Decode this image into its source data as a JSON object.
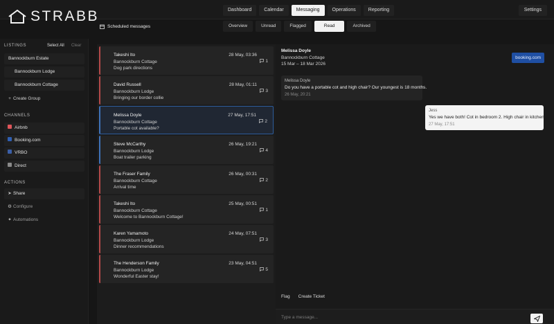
{
  "app": {
    "logo": "STRABB"
  },
  "nav": {
    "tabs": [
      "Dashboard",
      "Calendar",
      "Messaging",
      "Operations",
      "Reporting"
    ],
    "active": "Messaging",
    "settings": "Settings"
  },
  "sidebar": {
    "listings": {
      "title": "LISTINGS",
      "select_all": "Select All",
      "clear": "Clear",
      "items": [
        "Bannockburn Estate",
        "Bannockburn Lodge",
        "Bannockburn Cottage"
      ],
      "create_group": "Create Group"
    },
    "channels": {
      "title": "CHANNELS",
      "items": [
        {
          "label": "Airbnb",
          "color": "#e0555a"
        },
        {
          "label": "Booking.com",
          "color": "#2f5fb3"
        },
        {
          "label": "VRBO",
          "color": "#3b5fa8"
        },
        {
          "label": "Direct",
          "color": "#8a8a8a"
        }
      ]
    },
    "actions": {
      "title": "ACTIONS",
      "items": [
        {
          "label": "Share",
          "icon": "share-icon"
        },
        {
          "label": "Configure",
          "icon": "gear-icon"
        },
        {
          "label": "Automations",
          "icon": "sparkle-icon"
        }
      ]
    }
  },
  "header": {
    "scheduled": "Scheduled messages",
    "subtabs": [
      "Overview",
      "Unread",
      "Flagged",
      "Read",
      "Archived"
    ],
    "active_subtab": "Read"
  },
  "messages": [
    {
      "name": "Takeshi Ito",
      "date": "28 May, 03:36",
      "property": "Bannockburn Cottage",
      "subject": "Dog park directions",
      "count": "1",
      "channel": "airbnb"
    },
    {
      "name": "David Russell",
      "date": "28 May, 01:11",
      "property": "Bannockburn Lodge",
      "subject": "Bringing our border collie",
      "count": "3",
      "channel": "airbnb"
    },
    {
      "name": "Melissa Doyle",
      "date": "27 May, 17:51",
      "property": "Bannockburn Cottage",
      "subject": "Portable cot available?",
      "count": "2",
      "channel": "booking",
      "selected": true
    },
    {
      "name": "Steve McCarthy",
      "date": "26 May, 19:21",
      "property": "Bannockburn Lodge",
      "subject": "Boat trailer parking",
      "count": "4",
      "channel": "vrbo"
    },
    {
      "name": "The Fraser Family",
      "date": "26 May, 00:31",
      "property": "Bannockburn Cottage",
      "subject": "Arrival time",
      "count": "2",
      "channel": "airbnb"
    },
    {
      "name": "Takeshi Ito",
      "date": "25 May, 00:51",
      "property": "Bannockburn Cottage",
      "subject": "Welcome to Bannockburn Cottage!",
      "count": "1",
      "channel": "airbnb"
    },
    {
      "name": "Karen Yamamoto",
      "date": "24 May, 07:51",
      "property": "Bannockburn Lodge",
      "subject": "Dinner recommendations",
      "count": "3",
      "channel": "airbnb"
    },
    {
      "name": "The Henderson Family",
      "date": "23 May, 04:51",
      "property": "Bannockburn Lodge",
      "subject": "Wonderful Easter stay!",
      "count": "5",
      "channel": "airbnb"
    }
  ],
  "conversation": {
    "guest": "Melissa Doyle",
    "property": "Bannockburn Cottage",
    "dates": "15 Mar – 18 Mar 2026",
    "channel_badge": "booking.com",
    "thread": [
      {
        "from": "Melissa Doyle",
        "text": "Do you have a portable cot and high chair? Our youngest is 18 months.",
        "time": "26 May, 20:21",
        "direction": "in"
      },
      {
        "from": "Jess",
        "text": "Yes we have both! Cot in bedroom 2. High chair in kitchen.",
        "time": "27 May, 17:51",
        "direction": "out"
      }
    ],
    "actions": [
      "Flag",
      "Create Ticket"
    ],
    "composer_placeholder": "Type a message..."
  }
}
